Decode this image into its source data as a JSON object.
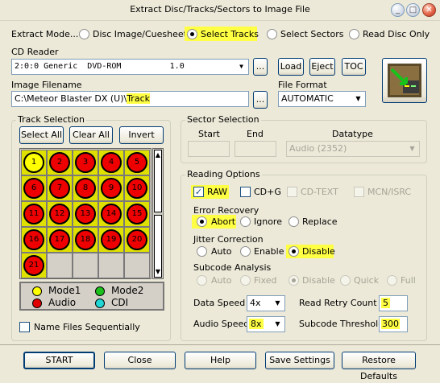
{
  "window": {
    "title": "Extract Disc/Tracks/Sectors to Image File",
    "close_glyph": "✕",
    "min_glyph": "_",
    "max_glyph": "□"
  },
  "extract_mode": {
    "label": "Extract Mode...",
    "options": [
      "Disc Image/Cuesheet",
      "Select Tracks",
      "Select Sectors",
      "Read Disc Only"
    ],
    "selected": "Select Tracks"
  },
  "cd_reader": {
    "label": "CD Reader",
    "value": "2:0:0 Generic  DVD-ROM          1.0",
    "browse": "...",
    "load": "Load",
    "eject": "Eject",
    "toc": "TOC"
  },
  "image_filename": {
    "label": "Image Filename",
    "prefix": "C:\\Meteor Blaster DX (U)\\",
    "highlight": "Track",
    "browse": "..."
  },
  "file_format": {
    "label": "File Format",
    "value": "AUTOMATIC"
  },
  "track_selection": {
    "label": "Track Selection",
    "select_all": "Select All",
    "clear_all": "Clear All",
    "invert": "Invert",
    "tracks": [
      "1",
      "2",
      "3",
      "4",
      "5",
      "6",
      "7",
      "8",
      "9",
      "10",
      "11",
      "12",
      "13",
      "14",
      "15",
      "16",
      "17",
      "18",
      "19",
      "20",
      "21"
    ],
    "legend": {
      "mode1": "Mode1",
      "mode2": "Mode2",
      "audio": "Audio",
      "cdi": "CDI"
    },
    "name_sequential": "Name Files Sequentially"
  },
  "sector_selection": {
    "label": "Sector Selection",
    "start": "Start",
    "end": "End",
    "datatype": "Datatype",
    "datatype_value": "Audio (2352)"
  },
  "reading_options": {
    "label": "Reading Options",
    "raw": "RAW",
    "cdg": "CD+G",
    "cdtext": "CD-TEXT",
    "mcn": "MCN/ISRC",
    "error_recovery": {
      "label": "Error Recovery",
      "abort": "Abort",
      "ignore": "Ignore",
      "replace": "Replace"
    },
    "jitter": {
      "label": "Jitter Correction",
      "auto": "Auto",
      "enable": "Enable",
      "disable": "Disable"
    },
    "subcode": {
      "label": "Subcode Analysis",
      "auto": "Auto",
      "fixed": "Fixed",
      "disable": "Disable",
      "quick": "Quick",
      "full": "Full"
    },
    "data_speed": {
      "label": "Data Speed",
      "value": "4x"
    },
    "retry": {
      "label": "Read Retry Count",
      "value": "5"
    },
    "audio_speed": {
      "label": "Audio Speed",
      "value": "8x"
    },
    "subcode_threshold": {
      "label": "Subcode Threshold",
      "value": "300"
    }
  },
  "footer": {
    "start": "START",
    "close": "Close",
    "help": "Help",
    "save": "Save Settings",
    "restore": "Restore Defaults"
  },
  "colors": {
    "highlight": "#ffff44",
    "audio": "#e00000",
    "mode1": "#ffff00",
    "mode2": "#1dc11d",
    "cdi": "#22d6d6"
  }
}
